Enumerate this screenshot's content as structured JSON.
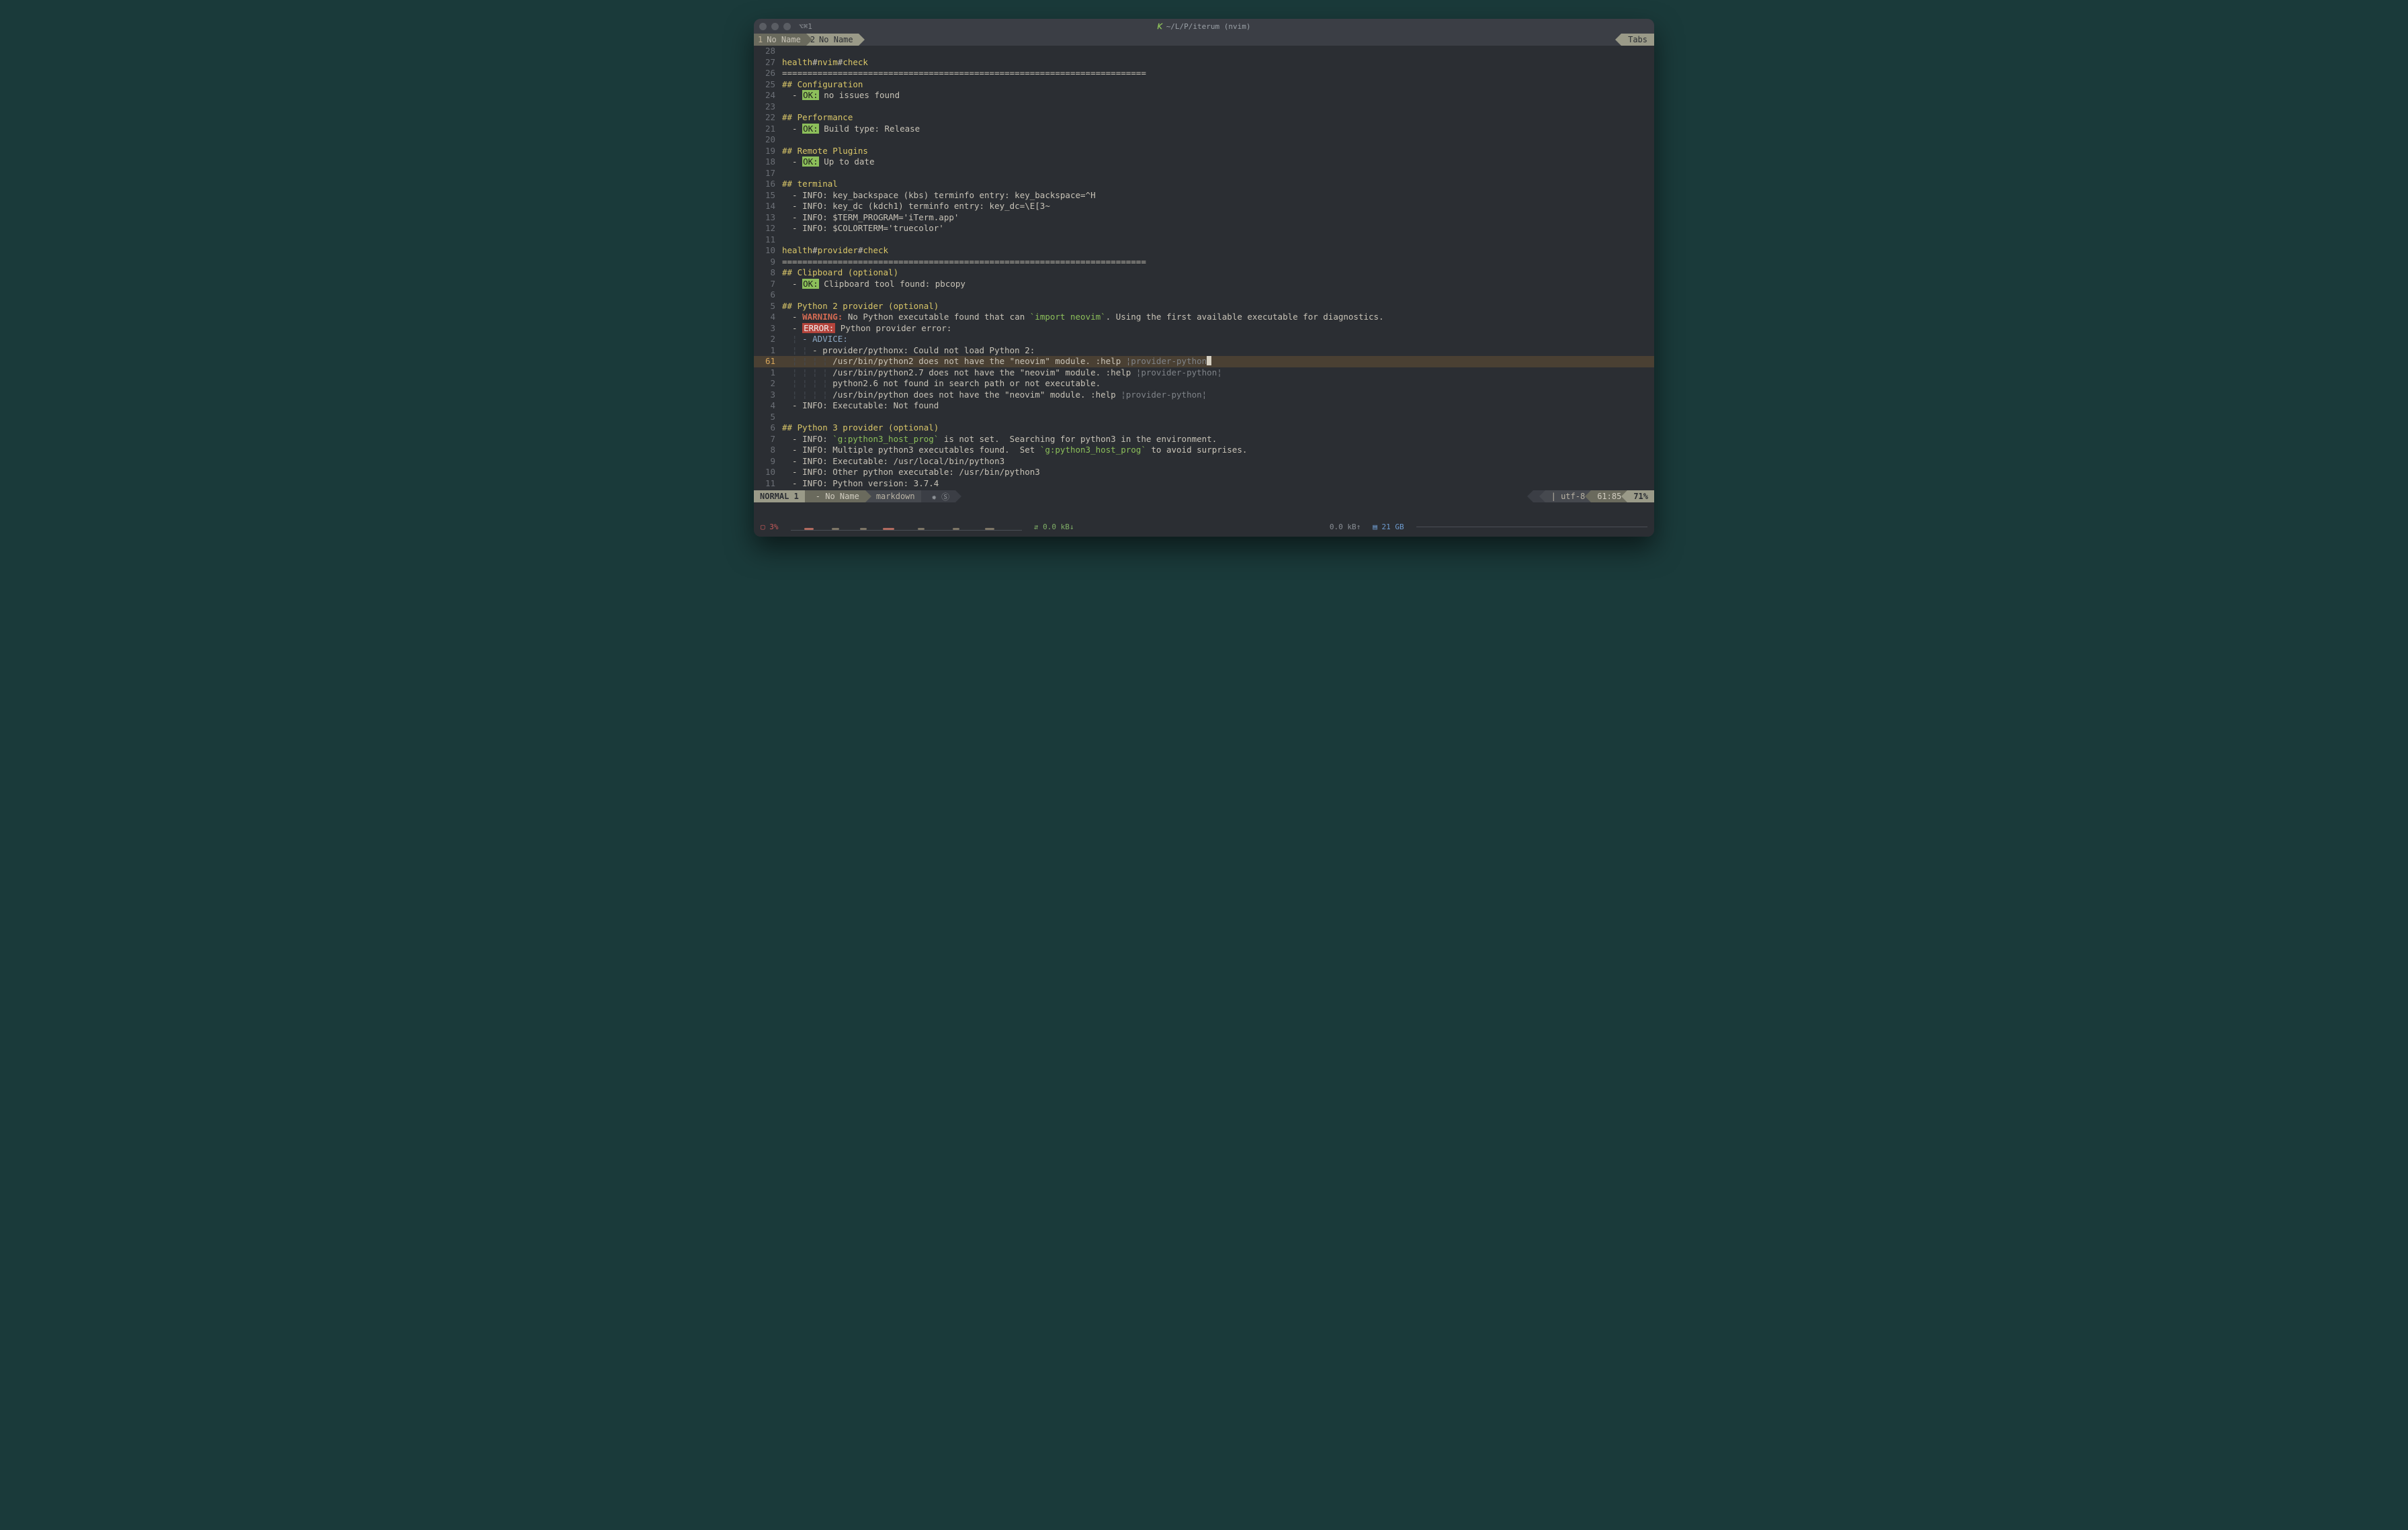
{
  "titlebar": {
    "session": "⌥⌘1",
    "prefix_icon": "𝘒",
    "path": "~/L/P/iterum (nvim)"
  },
  "tabs": {
    "items": [
      {
        "num": "1",
        "label": "No Name",
        "active": false
      },
      {
        "num": "2",
        "label": "No Name",
        "active": true
      }
    ],
    "right_label": "Tabs"
  },
  "status": {
    "mode": "NORMAL 1",
    "file": "- No Name",
    "filetype": "markdown",
    "sync": "✹ Ⓢ",
    "os_icon": "",
    "encoding": "utf-8",
    "position": "61:85",
    "percent": "71%"
  },
  "sysbar": {
    "battery": "▢ 3%",
    "net_down": "⇵ 0.0 kB↓",
    "net_up": "0.0 kB↑",
    "disk": "▤ 21 GB"
  },
  "lines": [
    {
      "n": "28",
      "segs": []
    },
    {
      "n": "27",
      "segs": [
        {
          "t": "health",
          "c": "y"
        },
        {
          "t": "#",
          "c": "c"
        },
        {
          "t": "nvim",
          "c": "y"
        },
        {
          "t": "#",
          "c": "c"
        },
        {
          "t": "check",
          "c": "y"
        }
      ]
    },
    {
      "n": "26",
      "segs": [
        {
          "t": "========================================================================",
          "c": "c"
        }
      ]
    },
    {
      "n": "25",
      "segs": [
        {
          "t": "## Configuration",
          "c": "y"
        }
      ]
    },
    {
      "n": "24",
      "segs": [
        {
          "t": "  - ",
          "c": "c"
        },
        {
          "t": "OK:",
          "c": "okbadge"
        },
        {
          "t": " no issues found",
          "c": "c"
        }
      ]
    },
    {
      "n": "23",
      "segs": []
    },
    {
      "n": "22",
      "segs": [
        {
          "t": "## Performance",
          "c": "y"
        }
      ]
    },
    {
      "n": "21",
      "segs": [
        {
          "t": "  - ",
          "c": "c"
        },
        {
          "t": "OK:",
          "c": "okbadge"
        },
        {
          "t": " Build type: Release",
          "c": "c"
        }
      ]
    },
    {
      "n": "20",
      "segs": []
    },
    {
      "n": "19",
      "segs": [
        {
          "t": "## Remote Plugins",
          "c": "y"
        }
      ]
    },
    {
      "n": "18",
      "segs": [
        {
          "t": "  - ",
          "c": "c"
        },
        {
          "t": "OK:",
          "c": "okbadge"
        },
        {
          "t": " Up to date",
          "c": "c"
        }
      ]
    },
    {
      "n": "17",
      "segs": []
    },
    {
      "n": "16",
      "segs": [
        {
          "t": "## terminal",
          "c": "y"
        }
      ]
    },
    {
      "n": "15",
      "segs": [
        {
          "t": "  - INFO: key_backspace (kbs) terminfo entry: key_backspace=^H",
          "c": "c"
        }
      ]
    },
    {
      "n": "14",
      "segs": [
        {
          "t": "  - INFO: key_dc (kdch1) terminfo entry: key_dc=\\E[3~",
          "c": "c"
        }
      ]
    },
    {
      "n": "13",
      "segs": [
        {
          "t": "  - INFO: $TERM_PROGRAM='iTerm.app'",
          "c": "c"
        }
      ]
    },
    {
      "n": "12",
      "segs": [
        {
          "t": "  - INFO: $COLORTERM='truecolor'",
          "c": "c"
        }
      ]
    },
    {
      "n": "11",
      "segs": []
    },
    {
      "n": "10",
      "segs": [
        {
          "t": "health",
          "c": "y"
        },
        {
          "t": "#",
          "c": "c"
        },
        {
          "t": "provider",
          "c": "y"
        },
        {
          "t": "#",
          "c": "c"
        },
        {
          "t": "check",
          "c": "y"
        }
      ]
    },
    {
      "n": "9",
      "segs": [
        {
          "t": "========================================================================",
          "c": "c"
        }
      ]
    },
    {
      "n": "8",
      "segs": [
        {
          "t": "## Clipboard (optional)",
          "c": "y"
        }
      ]
    },
    {
      "n": "7",
      "segs": [
        {
          "t": "  - ",
          "c": "c"
        },
        {
          "t": "OK:",
          "c": "okbadge"
        },
        {
          "t": " Clipboard tool found: pbcopy",
          "c": "c"
        }
      ]
    },
    {
      "n": "6",
      "segs": []
    },
    {
      "n": "5",
      "segs": [
        {
          "t": "## Python 2 provider (optional)",
          "c": "y"
        }
      ]
    },
    {
      "n": "4",
      "segs": [
        {
          "t": "  - ",
          "c": "c"
        },
        {
          "t": "WARNING:",
          "c": "warn"
        },
        {
          "t": " No Python executable found that can ",
          "c": "c"
        },
        {
          "t": "`import neovim`",
          "c": "g"
        },
        {
          "t": ". Using the first available executable for diagnostics.",
          "c": "c"
        }
      ]
    },
    {
      "n": "3",
      "segs": [
        {
          "t": "  - ",
          "c": "c"
        },
        {
          "t": "ERROR:",
          "c": "errbadge"
        },
        {
          "t": " Python provider error:",
          "c": "c"
        }
      ]
    },
    {
      "n": "2",
      "segs": [
        {
          "t": "  ¦ ",
          "c": "indent1"
        },
        {
          "t": "- ADVICE:",
          "c": "b"
        }
      ]
    },
    {
      "n": "1",
      "segs": [
        {
          "t": "  ¦ ¦ ",
          "c": "indent1"
        },
        {
          "t": "- provider/pythonx: Could not load Python 2:",
          "c": "c"
        }
      ]
    },
    {
      "n": "61",
      "current": true,
      "segs": [
        {
          "t": "  ¦ ¦ ¦ ¦ ",
          "c": "indent1"
        },
        {
          "t": "/usr/bin/python2 does not have the \"neovim\" module. :help ",
          "c": "c"
        },
        {
          "t": "¦provider-python",
          "c": "m"
        },
        {
          "t": "",
          "c": "cursor"
        }
      ]
    },
    {
      "n": "1",
      "segs": [
        {
          "t": "  ¦ ¦ ¦ ¦ ",
          "c": "indent1"
        },
        {
          "t": "/usr/bin/python2.7 does not have the \"neovim\" module. :help ",
          "c": "c"
        },
        {
          "t": "¦provider-python¦",
          "c": "m"
        }
      ]
    },
    {
      "n": "2",
      "segs": [
        {
          "t": "  ¦ ¦ ¦ ¦ ",
          "c": "indent1"
        },
        {
          "t": "python2.6 not found in search path or not executable.",
          "c": "c"
        }
      ]
    },
    {
      "n": "3",
      "segs": [
        {
          "t": "  ¦ ¦ ¦ ¦ ",
          "c": "indent1"
        },
        {
          "t": "/usr/bin/python does not have the \"neovim\" module. :help ",
          "c": "c"
        },
        {
          "t": "¦provider-python¦",
          "c": "m"
        }
      ]
    },
    {
      "n": "4",
      "segs": [
        {
          "t": "  - INFO: Executable: Not found",
          "c": "c"
        }
      ]
    },
    {
      "n": "5",
      "segs": []
    },
    {
      "n": "6",
      "segs": [
        {
          "t": "## Python 3 provider (optional)",
          "c": "y"
        }
      ]
    },
    {
      "n": "7",
      "segs": [
        {
          "t": "  - INFO: ",
          "c": "c"
        },
        {
          "t": "`g:python3_host_prog`",
          "c": "g"
        },
        {
          "t": " is not set.  Searching for python3 in the environment.",
          "c": "c"
        }
      ]
    },
    {
      "n": "8",
      "segs": [
        {
          "t": "  - INFO: Multiple python3 executables found.  Set ",
          "c": "c"
        },
        {
          "t": "`g:python3_host_prog`",
          "c": "g"
        },
        {
          "t": " to avoid surprises.",
          "c": "c"
        }
      ]
    },
    {
      "n": "9",
      "segs": [
        {
          "t": "  - INFO: Executable: /usr/local/bin/python3",
          "c": "c"
        }
      ]
    },
    {
      "n": "10",
      "segs": [
        {
          "t": "  - INFO: Other python executable: /usr/bin/python3",
          "c": "c"
        }
      ]
    },
    {
      "n": "11",
      "segs": [
        {
          "t": "  - INFO: Python version: 3.7.4",
          "c": "c"
        }
      ]
    }
  ]
}
